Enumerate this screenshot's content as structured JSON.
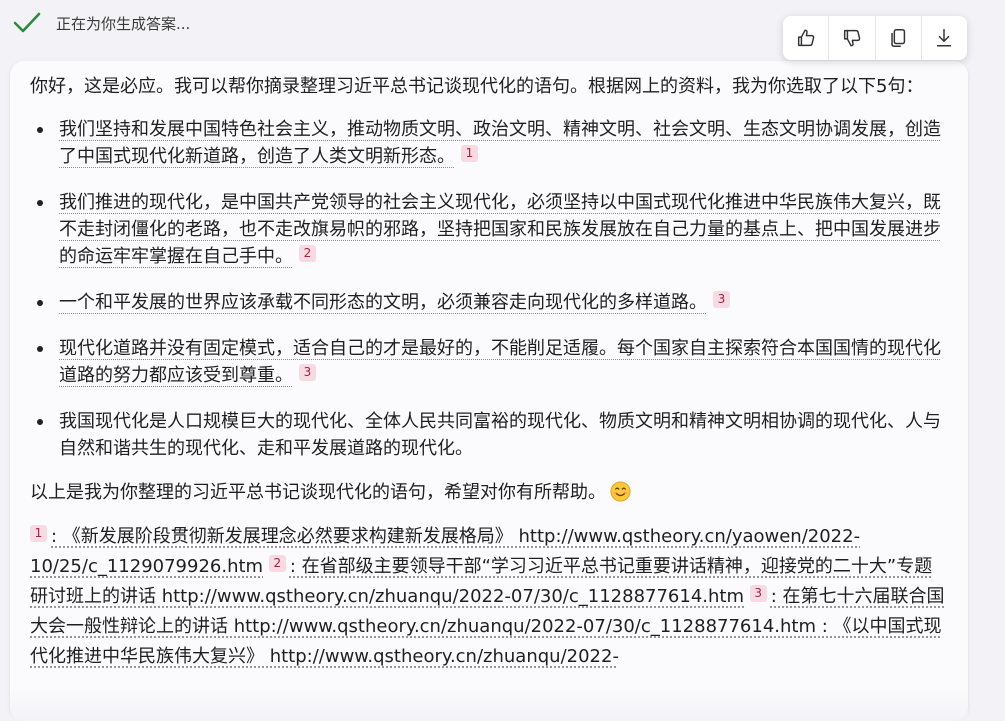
{
  "status": {
    "icon": "check-icon",
    "text": "正在为你生成答案..."
  },
  "toolbar": {
    "buttons": [
      {
        "icon": "thumbs-up-icon"
      },
      {
        "icon": "thumbs-down-icon"
      },
      {
        "icon": "copy-icon"
      },
      {
        "icon": "download-icon"
      }
    ]
  },
  "answer": {
    "intro": "你好，这是必应。我可以帮你摘录整理习近平总书记谈现代化的语句。根据网上的资料，我为你选取了以下5句：",
    "quotes": [
      {
        "text": "我们坚持和发展中国特色社会主义，推动物质文明、政治文明、精神文明、社会文明、生态文明协调发展，创造了中国式现代化新道路，创造了人类文明新形态。",
        "cite": "1"
      },
      {
        "text": "我们推进的现代化，是中国共产党领导的社会主义现代化，必须坚持以中国式现代化推进中华民族伟大复兴，既不走封闭僵化的老路，也不走改旗易帜的邪路，坚持把国家和民族发展放在自己力量的基点上、把中国发展进步的命运牢牢掌握在自己手中。",
        "cite": "2"
      },
      {
        "text": "一个和平发展的世界应该承载不同形态的文明，必须兼容走向现代化的多样道路。",
        "cite": "3"
      },
      {
        "text": "现代化道路并没有固定模式，适合自己的才是最好的，不能削足适履。每个国家自主探索符合本国国情的现代化道路的努力都应该受到尊重。",
        "cite": "3"
      },
      {
        "text": "我国现代化是人口规模巨大的现代化、全体人民共同富裕的现代化、物质文明和精神文明相协调的现代化、人与自然和谐共生的现代化、走和平发展道路的现代化。",
        "cite": ""
      }
    ],
    "summary": "以上是我为你整理的习近平总书记谈现代化的语句，希望对你有所帮助。",
    "summary_emoji": "smiling-face-emoji",
    "references": [
      {
        "num": "1",
        "text": ": 《新发展阶段贯彻新发展理念必然要求构建新发展格局》 http://www.qstheory.cn/yaowen/2022-10/25/c_1129079926.htm"
      },
      {
        "num": "2",
        "text": ": 在省部级主要领导干部“学习习近平总书记重要讲话精神，迎接党的二十大”专题研讨班上的讲话 http://www.qstheory.cn/zhuanqu/2022-07/30/c_1128877614.htm"
      },
      {
        "num": "3",
        "text": ": 在第七十六届联合国大会一般性辩论上的讲话 http://www.qstheory.cn/zhuanqu/2022-07/30/c_1128877614.htm : 《以中国式现代化推进中华民族伟大复兴》 http://www.qstheory.cn/zhuanqu/2022-"
      }
    ]
  },
  "colors": {
    "check": "#2e8b3d",
    "cite_bg": "#f7dbe2",
    "cite_text": "#a3243e",
    "page_bg": "#f3f2f6"
  }
}
